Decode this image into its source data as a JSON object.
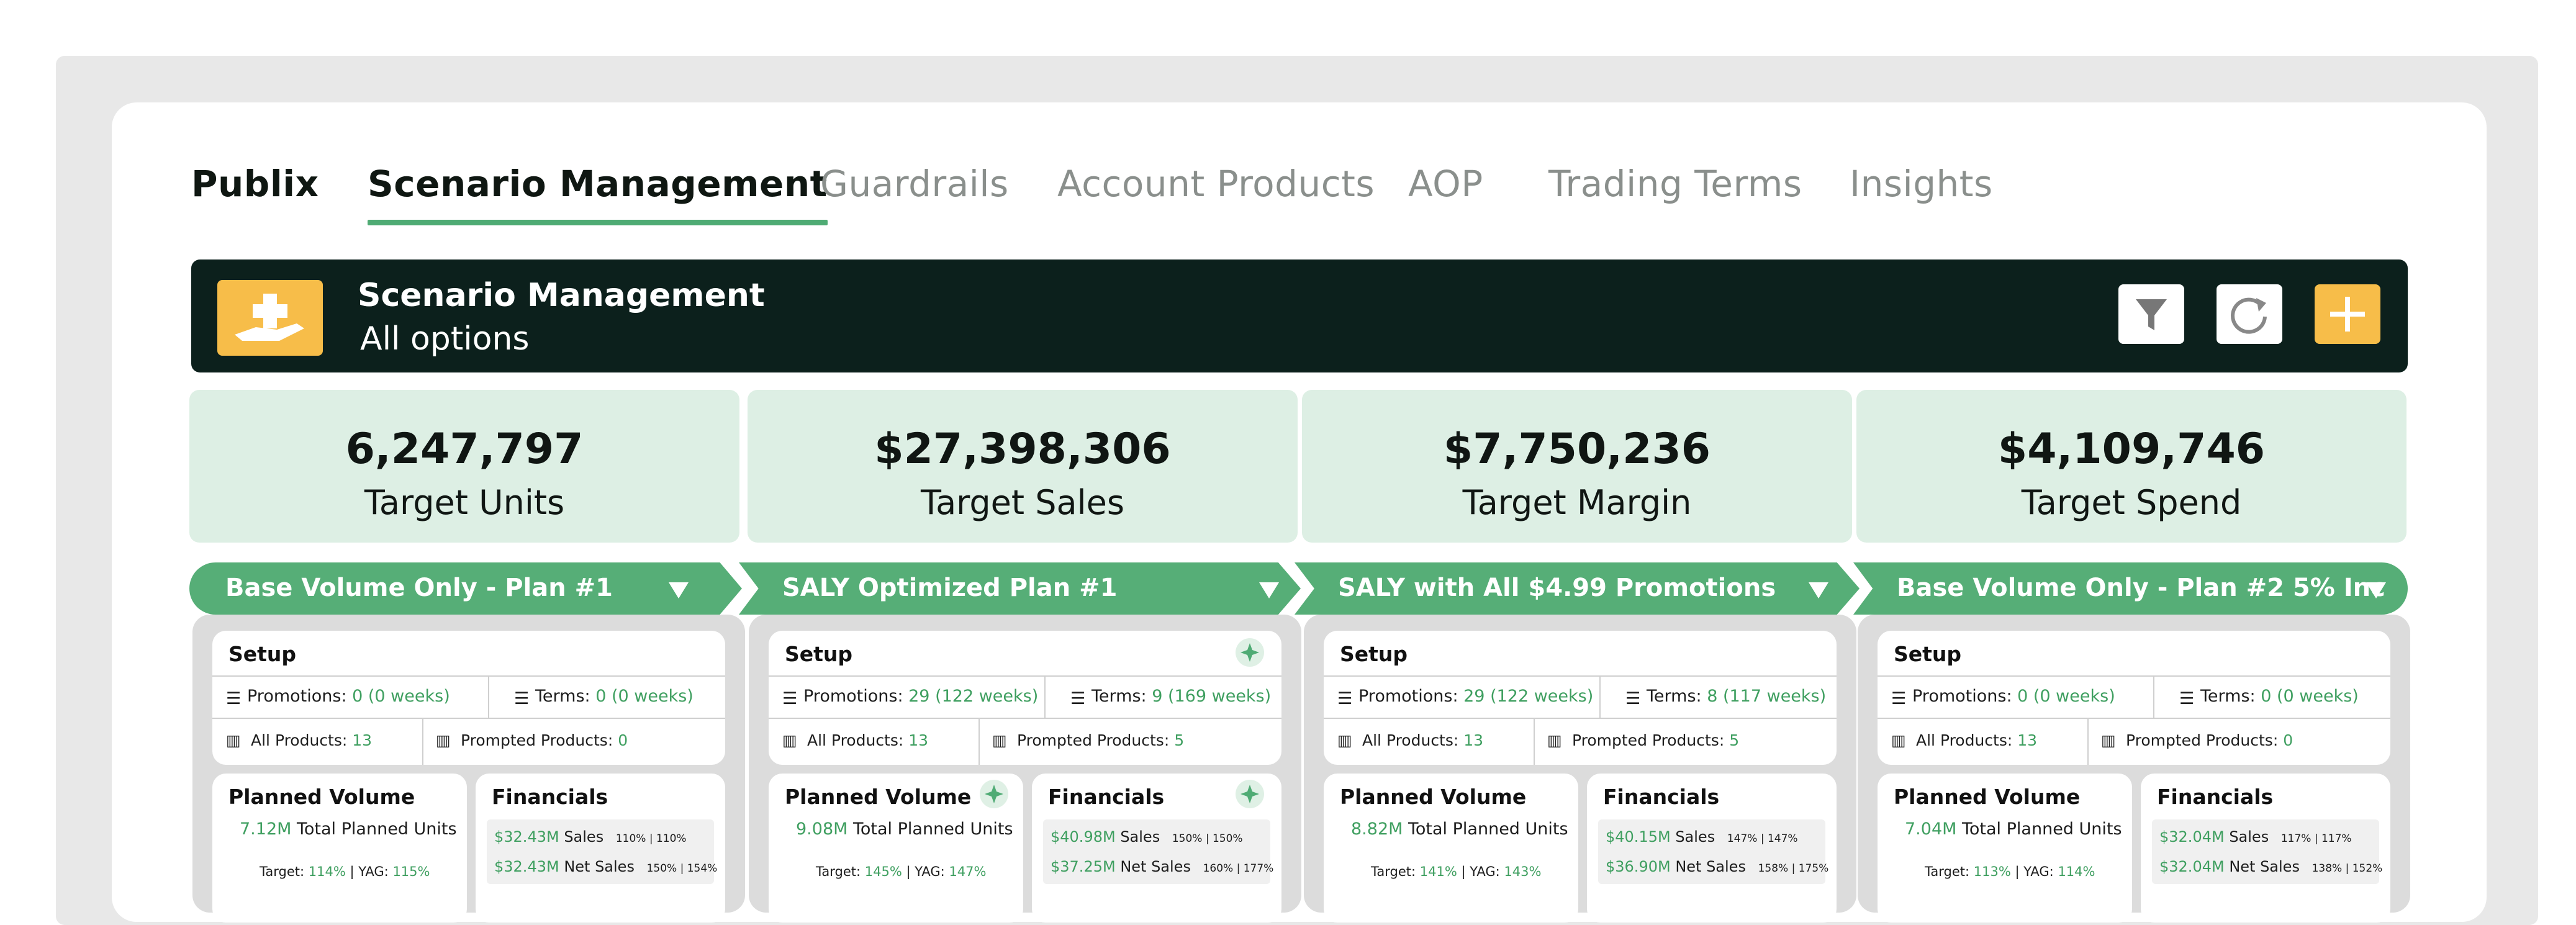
{
  "tabs": {
    "brand": "Publix",
    "active": "Scenario Management",
    "items": [
      "Guardrails",
      "Account Products",
      "AOP",
      "Trading Terms",
      "Insights"
    ]
  },
  "header": {
    "title": "Scenario Management",
    "subtitle": "All options",
    "icons": [
      "hand-plus-icon",
      "filter-icon",
      "refresh-icon",
      "plus-icon"
    ]
  },
  "kpis": [
    {
      "value": "6,247,797",
      "label": "Target Units"
    },
    {
      "value": "$27,398,306",
      "label": "Target Sales"
    },
    {
      "value": "$7,750,236",
      "label": "Target Margin"
    },
    {
      "value": "$4,109,746",
      "label": "Target Spend"
    }
  ],
  "labels": {
    "setup": "Setup",
    "promotions": "Promotions: ",
    "terms": "Terms: ",
    "all_products": "All Products: ",
    "prompted_products": "Prompted Products: ",
    "planned_volume": "Planned Volume",
    "total_planned_units": " Total Planned Units",
    "target": "Target: ",
    "yag": " | YAG: ",
    "financials": "Financials",
    "sales": " Sales",
    "net_sales": " Net Sales"
  },
  "scenarios": [
    {
      "name": "Base Volume Only - Plan #1",
      "promotions": "0 (0 weeks)",
      "terms": "0 (0 weeks)",
      "all_products": "13",
      "prompted_products": "0",
      "planned_units": "7.12M",
      "target_pct": "114%",
      "yag_pct": "115%",
      "sales": "$32.43M",
      "sales_small": "110% | 110%",
      "net_sales": "$32.43M",
      "net_sales_small": "150% | 154%",
      "sparkle": false
    },
    {
      "name": "SALY Optimized Plan #1",
      "promotions": "29 (122 weeks)",
      "terms": "9 (169 weeks)",
      "all_products": "13",
      "prompted_products": "5",
      "planned_units": "9.08M",
      "target_pct": "145%",
      "yag_pct": "147%",
      "sales": "$40.98M",
      "sales_small": "150% | 150%",
      "net_sales": "$37.25M",
      "net_sales_small": "160% | 177%",
      "sparkle": true
    },
    {
      "name": "SALY with All $4.99 Promotions",
      "promotions": "29 (122 weeks)",
      "terms": "8 (117 weeks)",
      "all_products": "13",
      "prompted_products": "5",
      "planned_units": "8.82M",
      "target_pct": "141%",
      "yag_pct": "143%",
      "sales": "$40.15M",
      "sales_small": "147% | 147%",
      "net_sales": "$36.90M",
      "net_sales_small": "158% | 175%",
      "sparkle": false
    },
    {
      "name": "Base Volume Only - Plan #2 5% Inc",
      "promotions": "0 (0 weeks)",
      "terms": "0 (0 weeks)",
      "all_products": "13",
      "prompted_products": "0",
      "planned_units": "7.04M",
      "target_pct": "113%",
      "yag_pct": "114%",
      "sales": "$32.04M",
      "sales_small": "117% | 117%",
      "net_sales": "$32.04M",
      "net_sales_small": "138% | 152%",
      "sparkle": false
    }
  ],
  "colors": {
    "accent": "#56ae77",
    "header_bg": "#0c201c",
    "kpi_bg": "#ddefe4",
    "button_yellow": "#f7bd49"
  }
}
